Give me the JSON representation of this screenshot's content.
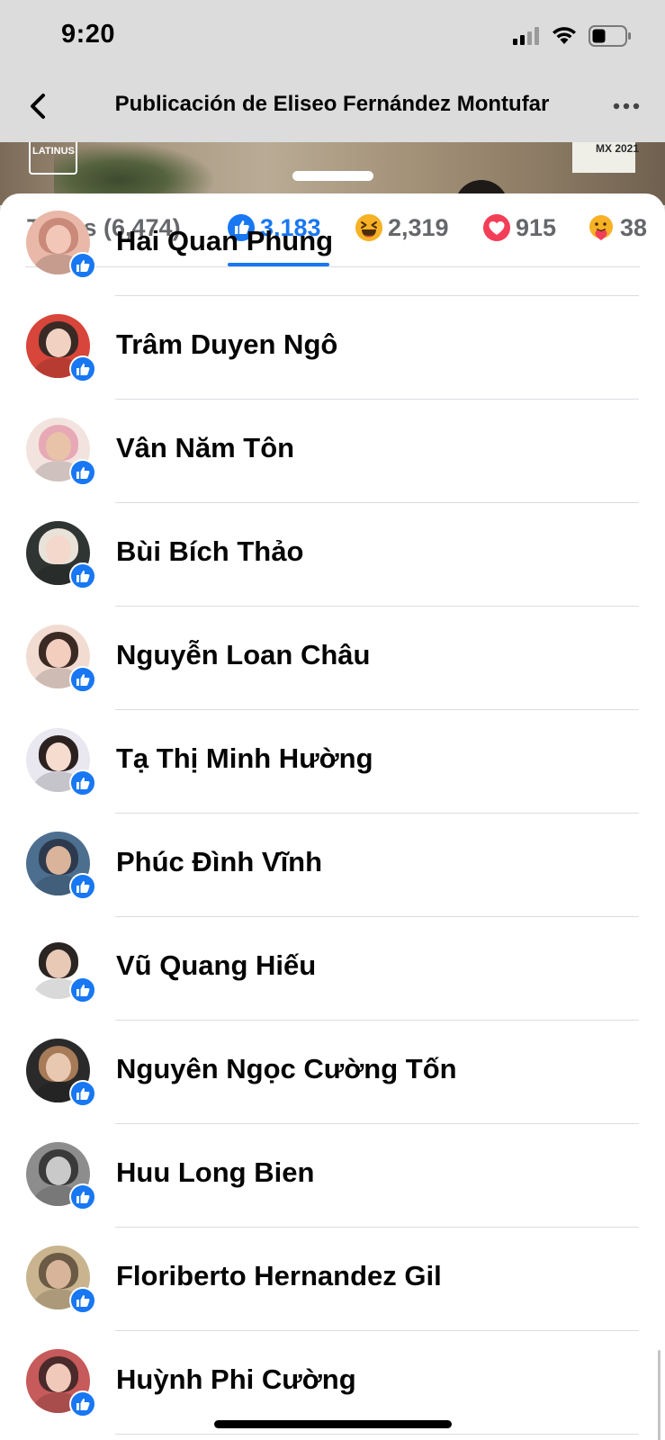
{
  "status_bar": {
    "time": "9:20"
  },
  "header": {
    "title": "Publicación de Eliseo Fernández Montufar"
  },
  "photo": {
    "logo_left": "LATINUS",
    "logo_right": "MX 2021"
  },
  "tabs": [
    {
      "label": "Todas (6,474)",
      "icon": null
    },
    {
      "label": "3,183",
      "icon": "like-icon",
      "selected": true
    },
    {
      "label": "2,319",
      "icon": "haha-icon"
    },
    {
      "label": "915",
      "icon": "love-icon"
    },
    {
      "label": "38",
      "icon": "care-icon"
    }
  ],
  "colors": {
    "accent": "#1877f2",
    "love": "#f33e58",
    "haha": "#f7b125"
  },
  "reactors": [
    {
      "name": "Hai Quan Phung",
      "reaction": "like"
    },
    {
      "name": "Trâm Duyen Ngô",
      "reaction": "like"
    },
    {
      "name": "Vân Năm Tôn",
      "reaction": "like"
    },
    {
      "name": "Bùi Bích Thảo",
      "reaction": "like"
    },
    {
      "name": "Nguyễn Loan Châu",
      "reaction": "like"
    },
    {
      "name": "Tạ Thị Minh Hường",
      "reaction": "like"
    },
    {
      "name": "Phúc Đình Vĩnh",
      "reaction": "like"
    },
    {
      "name": "Vũ Quang Hiếu",
      "reaction": "like"
    },
    {
      "name": "Nguyên Ngọc Cường Tốn",
      "reaction": "like"
    },
    {
      "name": "Huu Long Bien",
      "reaction": "like"
    },
    {
      "name": "Floriberto Hernandez Gil",
      "reaction": "like"
    },
    {
      "name": "Huỳnh Phi Cường",
      "reaction": "like"
    }
  ]
}
